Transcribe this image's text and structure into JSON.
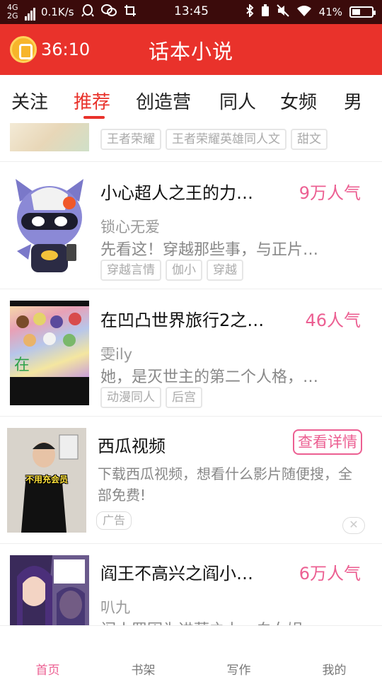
{
  "status_bar": {
    "net_type_1": "4G",
    "net_type_2": "2G",
    "speed": "0.1K/s",
    "time": "13:45",
    "battery": "41%",
    "battery_level": 0.41
  },
  "header": {
    "timer": "36:10",
    "title": "话本小说"
  },
  "tabs": [
    "关注",
    "推荐",
    "创造营",
    "同人",
    "女频",
    "男"
  ],
  "active_tab": "推荐",
  "cards": [
    {
      "title": "",
      "popularity": "",
      "author": "",
      "desc": "",
      "tags": [
        "王者荣耀",
        "王者荣耀英雄同人文",
        "甜文"
      ]
    },
    {
      "title": "小心超人之王的力…",
      "popularity": "9万人气",
      "author": "锁心无爱",
      "desc": "先看这！穿越那些事，与正片…",
      "tags": [
        "穿越言情",
        "伽小",
        "穿越"
      ]
    },
    {
      "title": "在凹凸世界旅行2之…",
      "popularity": "46人气",
      "author": "雯ily",
      "desc": "她，是灭世主的第二个人格，…",
      "tags": [
        "动漫同人",
        "后宫"
      ]
    },
    {
      "title": "阎王不高兴之阎小…",
      "popularity": "6万人气",
      "author": "叭九",
      "desc": "阎小罗因为进蒙之力，白女娲…",
      "tags": []
    }
  ],
  "ad": {
    "title": "西瓜视频",
    "button": "查看详情",
    "desc": "下载西瓜视频，想看什么影片随便搜，全部免费!",
    "label": "广告",
    "thumb_caption": "不用充会员"
  },
  "bottom_nav": [
    "首页",
    "书架",
    "写作",
    "我的"
  ],
  "colors": {
    "header": "#e9322b",
    "accent": "#ec5f92",
    "status_bar": "#3b0b0b"
  }
}
